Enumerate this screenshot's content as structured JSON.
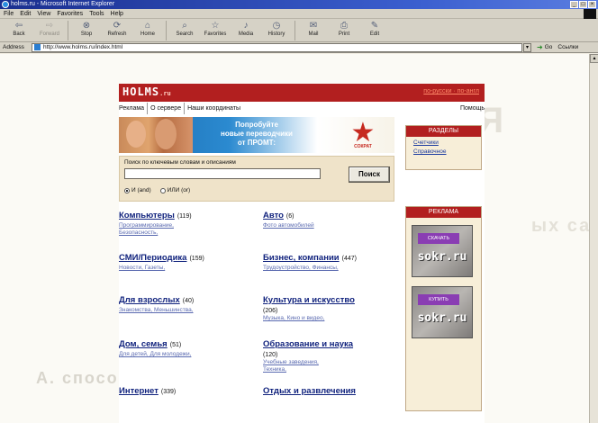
{
  "window": {
    "title": "holms.ru - Microsoft Internet Explorer"
  },
  "menu": [
    "File",
    "Edit",
    "View",
    "Favorites",
    "Tools",
    "Help"
  ],
  "toolbar": [
    {
      "label": "Back",
      "icon": "back-arrow-icon",
      "glyph": "⇦",
      "enabled": true
    },
    {
      "label": "Forward",
      "icon": "forward-arrow-icon",
      "glyph": "⇨",
      "enabled": false
    },
    {
      "label": "Stop",
      "icon": "stop-icon",
      "glyph": "⊗",
      "enabled": true
    },
    {
      "label": "Refresh",
      "icon": "refresh-icon",
      "glyph": "⟳",
      "enabled": true
    },
    {
      "label": "Home",
      "icon": "home-icon",
      "glyph": "⌂",
      "enabled": true
    },
    {
      "label": "Search",
      "icon": "search-icon",
      "glyph": "⌕",
      "enabled": true
    },
    {
      "label": "Favorites",
      "icon": "favorites-icon",
      "glyph": "☆",
      "enabled": true
    },
    {
      "label": "Media",
      "icon": "media-icon",
      "glyph": "♪",
      "enabled": true
    },
    {
      "label": "History",
      "icon": "history-icon",
      "glyph": "◷",
      "enabled": true
    },
    {
      "label": "Mail",
      "icon": "mail-icon",
      "glyph": "✉",
      "enabled": true
    },
    {
      "label": "Print",
      "icon": "print-icon",
      "glyph": "⎙",
      "enabled": true
    },
    {
      "label": "Edit",
      "icon": "edit-icon",
      "glyph": "✎",
      "enabled": true
    }
  ],
  "address": {
    "label": "Address",
    "url": "http://www.holms.ru/index.html",
    "go_label": "Go",
    "links_label": "Ссылки"
  },
  "page": {
    "logo": "HOLMS",
    "logo_domain": ".ru",
    "top_links": "по-русски · по-англ",
    "nav": [
      "Реклама",
      "О сервере",
      "Наши координаты"
    ],
    "help": "Помощь",
    "banner": {
      "line1": "Попробуйте",
      "line2": "новые переводчики",
      "line3": "от ПРОМТ:",
      "brand": "СОКРАТ"
    },
    "search": {
      "label": "Поиск по ключевым словам и описаниям",
      "value": "",
      "button": "Поиск",
      "radio_and": "И (and)",
      "radio_or": "ИЛИ (or)"
    },
    "sections": {
      "title": "РАЗДЕЛЫ",
      "links": [
        "Счетчики",
        "Справочное"
      ]
    },
    "ads": {
      "title": "РЕКЛАМА",
      "items": [
        {
          "strip": "СКАЧАТЬ",
          "brand": "sokr.ru"
        },
        {
          "strip": "КУПИТЬ",
          "brand": "sokr.ru"
        }
      ]
    },
    "categories": [
      {
        "title": "Компьютеры",
        "count": "(119)",
        "subs": [
          "Программирование,",
          "Безопасность,"
        ]
      },
      {
        "title": "Авто",
        "count": "(6)",
        "subs": [
          "Фото автомобилей"
        ]
      },
      {
        "title": "СМИ/Периодика",
        "count": "(159)",
        "subs": [
          "Новости, Газеты,"
        ]
      },
      {
        "title": "Бизнес, компании",
        "count": "(447)",
        "subs": [
          "Трудоустройство, Финансы,"
        ]
      },
      {
        "title": "Для взрослых",
        "count": "(40)",
        "subs": [
          "Знакомства, Меньшинства,"
        ]
      },
      {
        "title": "Культура и искусство",
        "count": "",
        "note": "(206)",
        "subs": [
          "Музыка, Кино и видео,"
        ]
      },
      {
        "title": "Дом, семья",
        "count": "(51)",
        "subs": [
          "Для детей, Для молодежи,"
        ]
      },
      {
        "title": "Образование и наука",
        "count": "",
        "note": "(120)",
        "subs": [
          "Учебные заведения,",
          "Техника,"
        ]
      },
      {
        "title": "Интернет",
        "count": "(339)",
        "subs": []
      },
      {
        "title": "Отдых и развлечения",
        "count": "",
        "subs": []
      }
    ]
  },
  "background_text": [
    "ЕНИЯ",
    "ых сайтов",
    "A. способ"
  ]
}
